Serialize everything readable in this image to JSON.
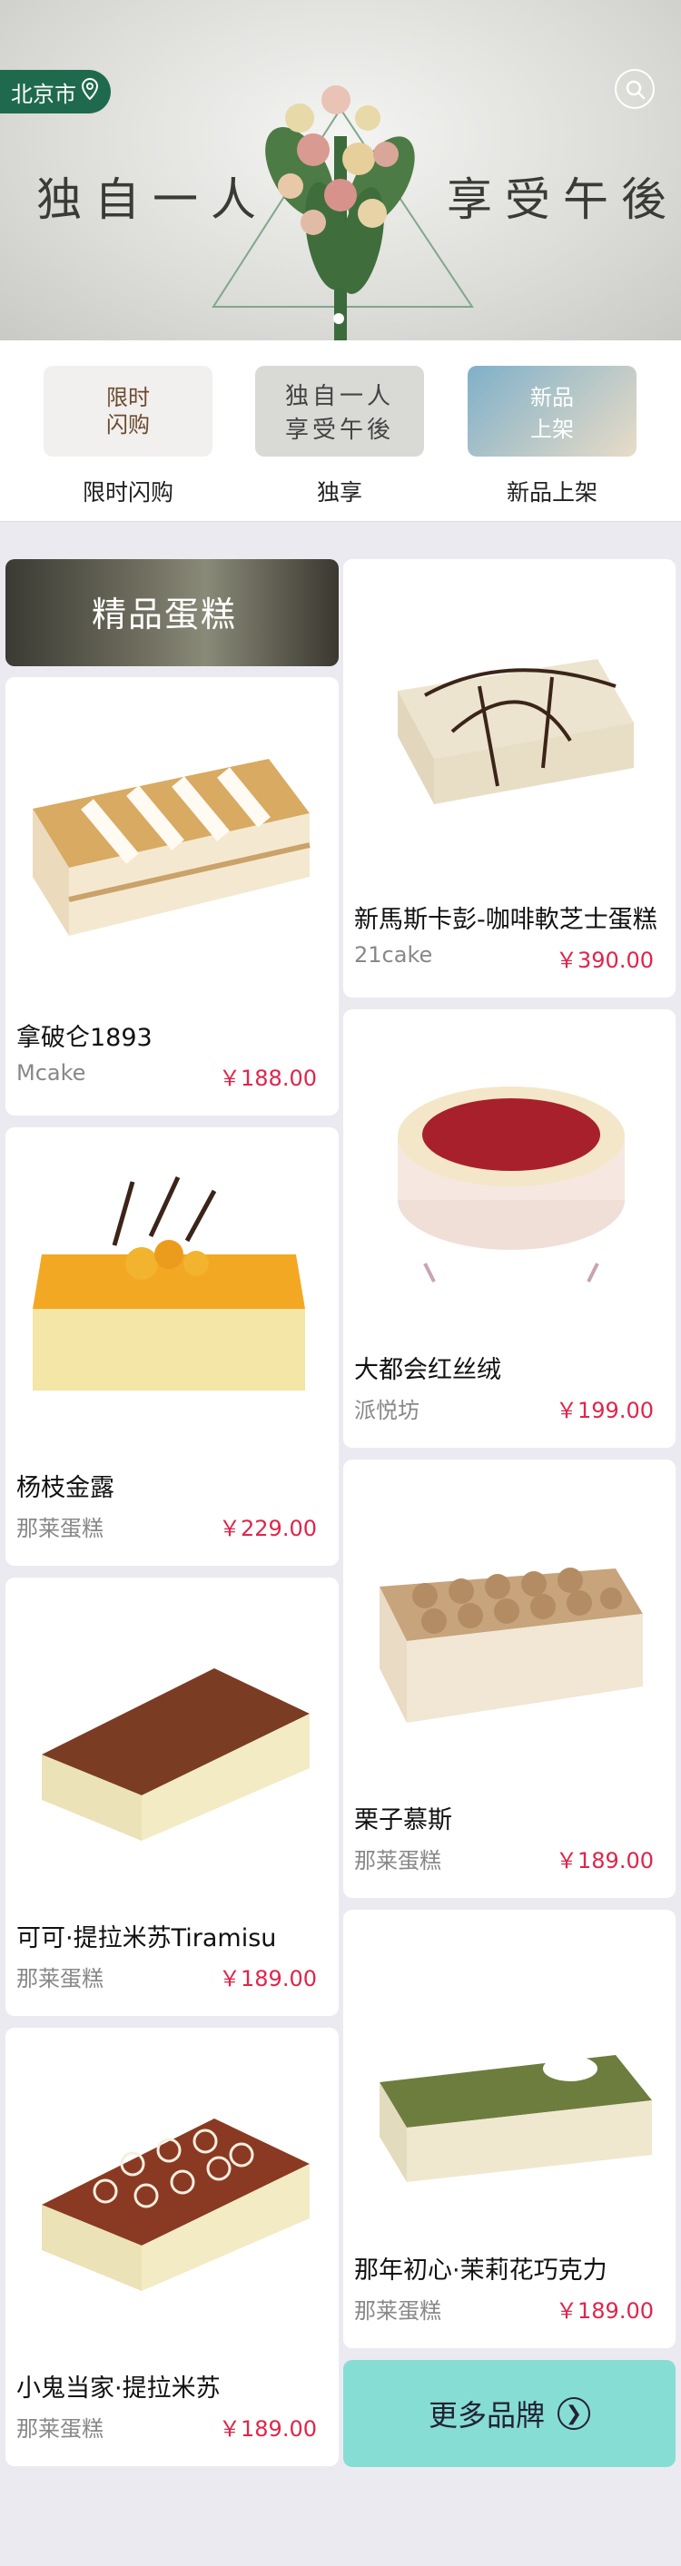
{
  "header": {
    "city": "北京市",
    "slogan_left": "独自一人",
    "slogan_right": "享受午後"
  },
  "categories": [
    {
      "label": "限时闪购",
      "thumb_text": "限时\n闪购"
    },
    {
      "label": "独享",
      "thumb_text": "独自一人\n享受午後"
    },
    {
      "label": "新品上架",
      "thumb_text": "新品\n上架"
    }
  ],
  "section": {
    "title": "精品蛋糕"
  },
  "products": [
    {
      "name": "新馬斯卡彭-咖啡軟芝士蛋糕",
      "brand": "21cake",
      "price": "￥390.00"
    },
    {
      "name": "拿破仑1893",
      "brand": "Mcake",
      "price": "￥188.00"
    },
    {
      "name": "大都会红丝绒",
      "brand": "派悦坊",
      "price": "￥199.00"
    },
    {
      "name": "杨枝金露",
      "brand": "那莱蛋糕",
      "price": "￥229.00"
    },
    {
      "name": "栗子慕斯",
      "brand": "那莱蛋糕",
      "price": "￥189.00"
    },
    {
      "name": "可可·提拉米苏Tiramisu",
      "brand": "那莱蛋糕",
      "price": "￥189.00"
    },
    {
      "name": "那年初心·茉莉花巧克力",
      "brand": "那莱蛋糕",
      "price": "￥189.00"
    },
    {
      "name": "小鬼当家·提拉米苏",
      "brand": "那莱蛋糕",
      "price": "￥189.00"
    }
  ],
  "more_button": {
    "label": "更多品牌"
  },
  "colors": {
    "price": "#e0254b",
    "city_badge": "#1f6a4f",
    "more_button": "#86ddd3"
  }
}
